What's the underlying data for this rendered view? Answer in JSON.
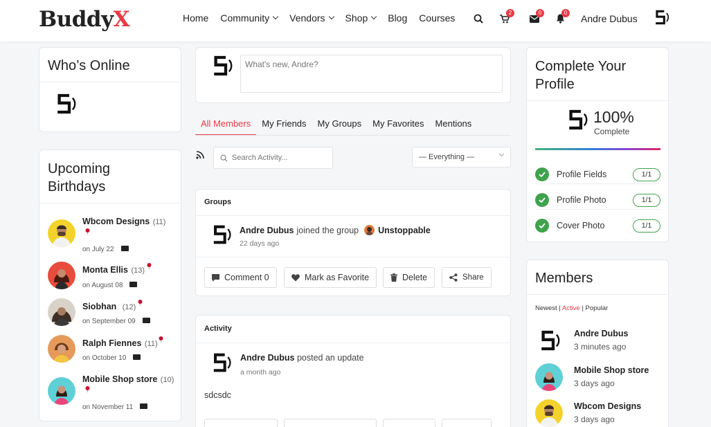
{
  "header": {
    "logo_main": "Buddy",
    "logo_x": "X",
    "nav": [
      {
        "label": "Home",
        "has_dropdown": false
      },
      {
        "label": "Community",
        "has_dropdown": true
      },
      {
        "label": "Vendors",
        "has_dropdown": true
      },
      {
        "label": "Shop",
        "has_dropdown": true
      },
      {
        "label": "Blog",
        "has_dropdown": false
      },
      {
        "label": "Courses",
        "has_dropdown": false
      }
    ],
    "cart_badge": "2",
    "messages_badge": "0",
    "notifications_badge": "0",
    "user_name": "Andre Dubus"
  },
  "whos_online": {
    "title": "Who’s Online"
  },
  "birthdays": {
    "title_line1": "Upcoming",
    "title_line2": "Birthdays",
    "items": [
      {
        "name": "Wbcom Designs",
        "count": "(11)",
        "date": "on July 22"
      },
      {
        "name": "Monta Ellis",
        "count": "(13)",
        "date": "on August 08"
      },
      {
        "name": "Siobhan",
        "count": "(12)",
        "date": "on September 09"
      },
      {
        "name": "Ralph Fiennes",
        "count": "(11)",
        "date": "on October 10"
      },
      {
        "name": "Mobile Shop store",
        "count": "(10)",
        "date": "on November 11"
      }
    ]
  },
  "post_box": {
    "placeholder": "What's new, Andre?"
  },
  "tabs": [
    "All Members",
    "My Friends",
    "My Groups",
    "My Favorites",
    "Mentions"
  ],
  "search": {
    "placeholder": "Search Activity..."
  },
  "filter": {
    "selected": "— Everything —"
  },
  "activity1": {
    "section": "Groups",
    "actor": "Andre Dubus",
    "action": "joined the group",
    "group": "Unstoppable",
    "time": "22 days ago",
    "comment_label": "Comment 0",
    "favorite_label": "Mark as Favorite",
    "delete_label": "Delete",
    "share_label": "Share"
  },
  "activity2": {
    "section": "Activity",
    "actor": "Andre Dubus",
    "action": "posted an update",
    "time": "a month ago",
    "content": "sdcsdc"
  },
  "profile": {
    "title_line1": "Complete Your",
    "title_line2": "Profile",
    "percent": "100%",
    "percent_label": "Complete",
    "items": [
      {
        "label": "Profile Fields",
        "value": "1/1"
      },
      {
        "label": "Profile Photo",
        "value": "1/1"
      },
      {
        "label": "Cover Photo",
        "value": "1/1"
      }
    ]
  },
  "members": {
    "title": "Members",
    "filter_newest": "Newest",
    "filter_active": "Active",
    "filter_popular": "Popular",
    "sep": "|",
    "items": [
      {
        "name": "Andre Dubus",
        "time": "3 minutes ago"
      },
      {
        "name": "Mobile Shop store",
        "time": "3 days ago"
      },
      {
        "name": "Wbcom Designs",
        "time": "3 days ago"
      }
    ]
  },
  "colors": {
    "accent": "#e93a44",
    "success": "#3fa34d"
  }
}
